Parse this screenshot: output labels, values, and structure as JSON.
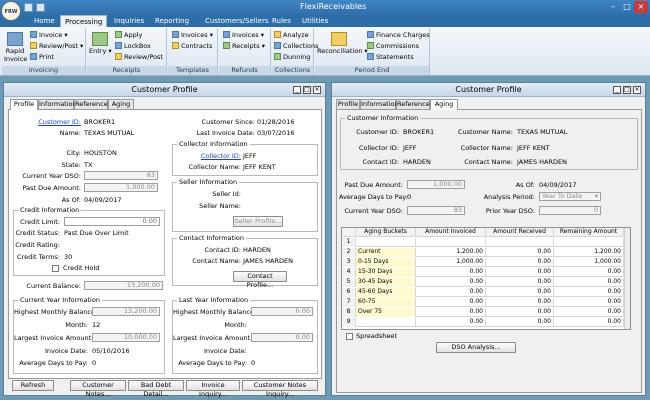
{
  "app": {
    "title": "FlexiReceivables",
    "logo_text": "FRW"
  },
  "menu": {
    "tabs": [
      "Home",
      "Processing",
      "Inquiries",
      "Reporting",
      "Customers/Sellers",
      "Rules",
      "Utilities"
    ],
    "active": "Processing"
  },
  "ribbon": {
    "groups": [
      {
        "label": "Invoicing",
        "items": [
          "Rapid Invoice",
          "Invoice",
          "Review/Post",
          "Print"
        ]
      },
      {
        "label": "Receipts",
        "items": [
          "Entry",
          "Apply",
          "LockBox",
          "Review/Post"
        ]
      },
      {
        "label": "Templates",
        "items": [
          "Invoices",
          "Contracts"
        ]
      },
      {
        "label": "Refunds",
        "items": [
          "Invoices",
          "Receipts"
        ]
      },
      {
        "label": "Collections",
        "items": [
          "Analyze",
          "Collections",
          "Dunning"
        ]
      },
      {
        "label": "Period End",
        "items": [
          "Reconciliation",
          "Finance Charges",
          "Commissions",
          "Statements"
        ]
      }
    ]
  },
  "left": {
    "title": "Customer Profile",
    "tabs": [
      "Profile",
      "Information",
      "Reference",
      "Aging"
    ],
    "active_tab": "Profile",
    "customer_id_label": "Customer ID:",
    "customer_id": "BROKER1",
    "name_label": "Name:",
    "name": "TEXAS MUTUAL",
    "city_label": "City:",
    "city": "HOUSTON",
    "state_label": "State:",
    "state": "TX",
    "current_year_dso_label": "Current Year DSO:",
    "current_year_dso": "83",
    "past_due_amount_label": "Past Due Amount:",
    "past_due_amount": "1,000.00",
    "as_of_label": "As Of:",
    "as_of": "04/09/2017",
    "customer_since_label": "Customer Since:",
    "customer_since": "01/28/2016",
    "last_invoice_date_label": "Last Invoice Date:",
    "last_invoice_date": "03/07/2016",
    "collector_info": {
      "legend": "Collector Information",
      "collector_id_label": "Collector ID:",
      "collector_id": "JEFF",
      "collector_name_label": "Collector Name:",
      "collector_name": "JEFF KENT"
    },
    "seller_info": {
      "legend": "Seller Information",
      "seller_id_label": "Seller Id:",
      "seller_name_label": "Seller Name:",
      "seller_profile_button": "Seller Profile..."
    },
    "contact_info": {
      "legend": "Contact Information",
      "contact_id_label": "Contact ID:",
      "contact_id": "HARDEN",
      "contact_name_label": "Contact Name:",
      "contact_name": "JAMES HARDEN",
      "contact_profile_button": "Contact Profile..."
    },
    "credit_info": {
      "legend": "Credit Information",
      "credit_limit_label": "Credit Limit:",
      "credit_limit": "0.00",
      "credit_status_label": "Credit Status:",
      "credit_status": "Past Due Over Limit",
      "credit_rating_label": "Credit Rating:",
      "credit_terms_label": "Credit Terms:",
      "credit_terms": "30",
      "credit_hold_label": "Credit Hold"
    },
    "current_balance_label": "Current Balance:",
    "current_balance": "13,200.00",
    "current_year_info": {
      "legend": "Current Year Information",
      "highest_monthly_balance_label": "Highest Monthly Balance:",
      "highest_monthly_balance": "13,200.00",
      "month_label": "Month:",
      "month": "12",
      "largest_invoice_amount_label": "Largest Invoice Amount:",
      "largest_invoice_amount": "10,000.00",
      "invoice_date_label": "Invoice Date:",
      "invoice_date": "05/10/2016",
      "avg_days_to_pay_label": "Average Days to Pay:",
      "avg_days_to_pay": "0"
    },
    "last_year_info": {
      "legend": "Last Year Information",
      "highest_monthly_balance_label": "Highest Monthly Balance:",
      "highest_monthly_balance": "0.00",
      "month_label": "Month:",
      "largest_invoice_amount_label": "Largest Invoice Amount:",
      "largest_invoice_amount": "0.00",
      "invoice_date_label": "Invoice Date:",
      "avg_days_to_pay_label": "Average Days to Pay:",
      "avg_days_to_pay": "0"
    },
    "buttons": [
      "Refresh",
      "Customer Notes...",
      "Bad Debt Detail...",
      "Invoice Inquiry...",
      "Customer Notes Inquiry..."
    ]
  },
  "right": {
    "title": "Customer Profile",
    "tabs": [
      "Profile",
      "Information",
      "Reference",
      "Aging"
    ],
    "active_tab": "Aging",
    "customer_info": {
      "legend": "Customer Information",
      "customer_id_label": "Customer ID:",
      "customer_id": "BROKER1",
      "customer_name_label": "Customer Name:",
      "customer_name": "TEXAS MUTUAL",
      "collector_id_label": "Collector ID:",
      "collector_id": "JEFF",
      "collector_name_label": "Collector Name:",
      "collector_name": "JEFF KENT",
      "contact_id_label": "Contact ID:",
      "contact_id": "HARDEN",
      "contact_name_label": "Contact Name:",
      "contact_name": "JAMES HARDEN"
    },
    "past_due_amount_label": "Past Due Amount:",
    "past_due_amount": "1,000.00",
    "avg_days_to_pay_label": "Average Days to Pay:",
    "avg_days_to_pay": "0",
    "current_year_dso_label": "Current Year DSO:",
    "current_year_dso": "83",
    "as_of_label": "As Of:",
    "as_of": "04/09/2017",
    "analysis_period_label": "Analysis Period:",
    "analysis_period": "Year To Date",
    "prior_year_dso_label": "Prior Year DSO:",
    "prior_year_dso": "0",
    "grid": {
      "headers": [
        "Aging Buckets",
        "Amount Invoiced",
        "Amount Received",
        "Remaining Amount"
      ],
      "rows": [
        {
          "n": "1",
          "bucket": "",
          "invoiced": "",
          "received": "",
          "remaining": ""
        },
        {
          "n": "2",
          "bucket": "Current",
          "invoiced": "1,200.00",
          "received": "0.00",
          "remaining": "1,200.00"
        },
        {
          "n": "3",
          "bucket": "0-15 Days",
          "invoiced": "1,000.00",
          "received": "0.00",
          "remaining": "1,000.00"
        },
        {
          "n": "4",
          "bucket": "15-30 Days",
          "invoiced": "0.00",
          "received": "0.00",
          "remaining": "0.00"
        },
        {
          "n": "5",
          "bucket": "30-45 Days",
          "invoiced": "0.00",
          "received": "0.00",
          "remaining": "0.00"
        },
        {
          "n": "6",
          "bucket": "45-60 Days",
          "invoiced": "0.00",
          "received": "0.00",
          "remaining": "0.00"
        },
        {
          "n": "7",
          "bucket": "60-75",
          "invoiced": "0.00",
          "received": "0.00",
          "remaining": "0.00"
        },
        {
          "n": "8",
          "bucket": "Over 75",
          "invoiced": "0.00",
          "received": "0.00",
          "remaining": "0.00"
        },
        {
          "n": "9",
          "bucket": "",
          "invoiced": "0.00",
          "received": "0.00",
          "remaining": "0.00"
        }
      ]
    },
    "spreadsheet_label": "Spreadsheet",
    "dso_button": "DSO Analysis..."
  }
}
